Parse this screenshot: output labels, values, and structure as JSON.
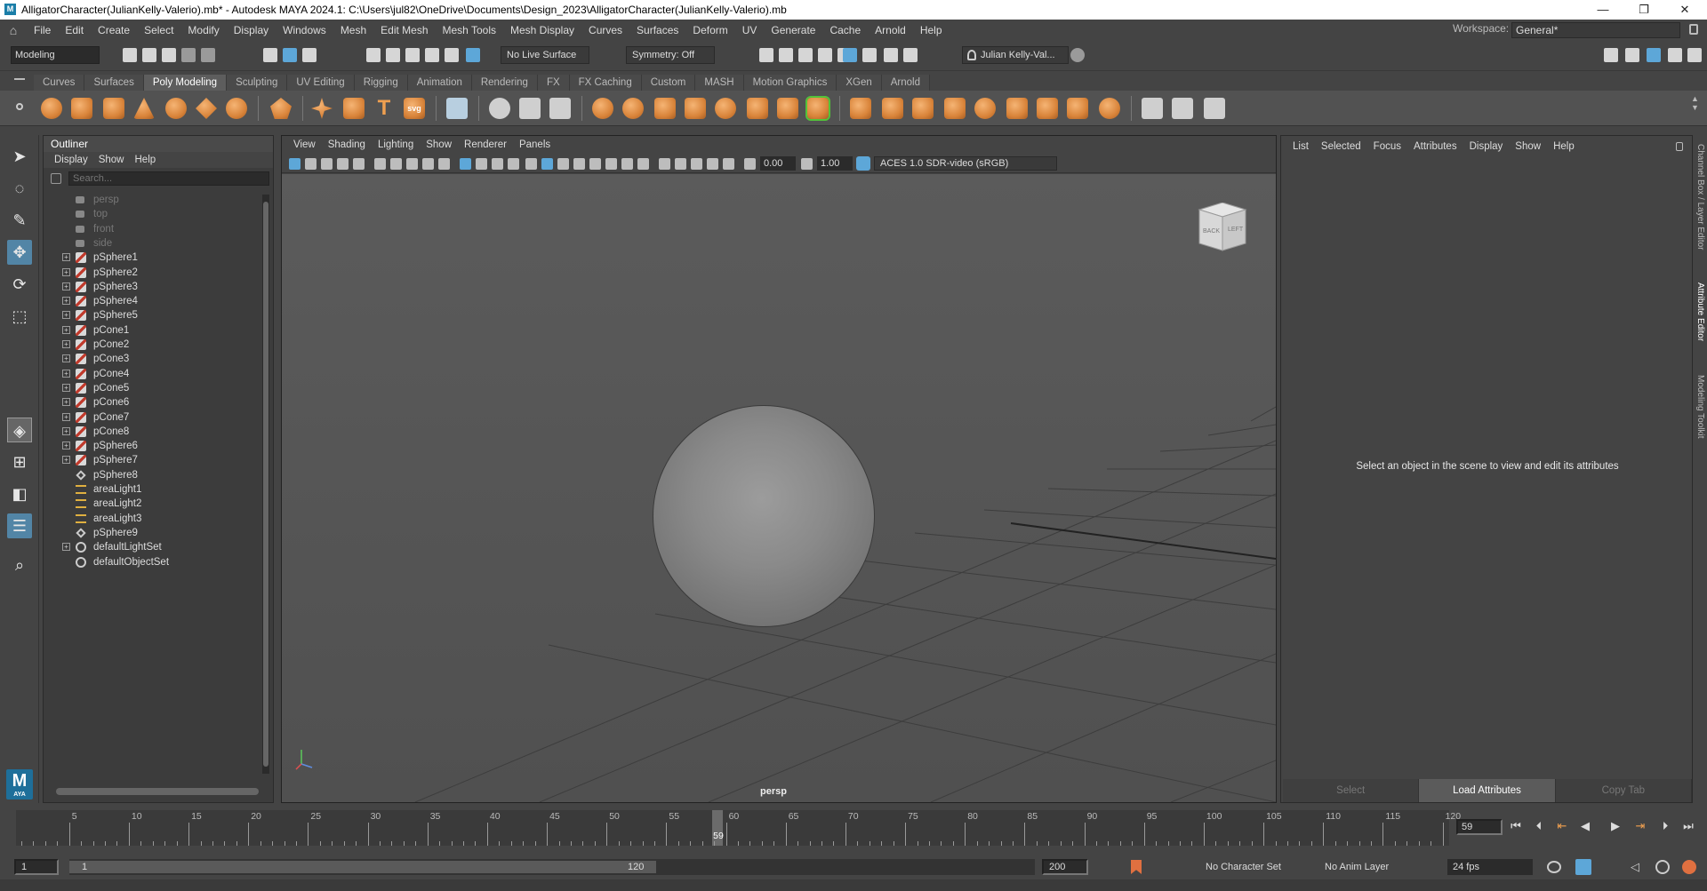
{
  "window": {
    "title": "AlligatorCharacter(JulianKelly-Valerio).mb* - Autodesk MAYA 2024.1: C:\\Users\\jul82\\OneDrive\\Documents\\Design_2023\\AlligatorCharacter(JulianKelly-Valerio).mb",
    "minimize": "—",
    "maximize": "❐",
    "close": "✕"
  },
  "menubar": {
    "items": [
      "File",
      "Edit",
      "Create",
      "Select",
      "Modify",
      "Display",
      "Windows",
      "Mesh",
      "Edit Mesh",
      "Mesh Tools",
      "Mesh Display",
      "Curves",
      "Surfaces",
      "Deform",
      "UV",
      "Generate",
      "Cache",
      "Arnold",
      "Help"
    ],
    "workspace_label": "Workspace:",
    "workspace_value": "General*"
  },
  "statusline": {
    "mode": "Modeling",
    "live_surface": "No Live Surface",
    "symmetry": "Symmetry: Off",
    "user": "Julian Kelly-Val..."
  },
  "shelf": {
    "tabs": [
      "Curves",
      "Surfaces",
      "Poly Modeling",
      "Sculpting",
      "UV Editing",
      "Rigging",
      "Animation",
      "Rendering",
      "FX",
      "FX Caching",
      "Custom",
      "MASH",
      "Motion Graphics",
      "XGen",
      "Arnold"
    ],
    "active_tab": "Poly Modeling",
    "svg_icon_text": "svg",
    "text_icon": "T"
  },
  "outliner": {
    "title": "Outliner",
    "menu": [
      "Display",
      "Show",
      "Help"
    ],
    "search_placeholder": "Search...",
    "items": [
      {
        "label": "persp",
        "icon": "camera-icon",
        "dim": true,
        "expand": false
      },
      {
        "label": "top",
        "icon": "camera-icon",
        "dim": true,
        "expand": false
      },
      {
        "label": "front",
        "icon": "camera-icon",
        "dim": true,
        "expand": false
      },
      {
        "label": "side",
        "icon": "camera-icon",
        "dim": true,
        "expand": false
      },
      {
        "label": "pSphere1",
        "icon": "mesh-icon",
        "dim": false,
        "expand": true
      },
      {
        "label": "pSphere2",
        "icon": "mesh-icon",
        "dim": false,
        "expand": true
      },
      {
        "label": "pSphere3",
        "icon": "mesh-icon",
        "dim": false,
        "expand": true
      },
      {
        "label": "pSphere4",
        "icon": "mesh-icon",
        "dim": false,
        "expand": true
      },
      {
        "label": "pSphere5",
        "icon": "mesh-icon",
        "dim": false,
        "expand": true
      },
      {
        "label": "pCone1",
        "icon": "mesh-icon",
        "dim": false,
        "expand": true
      },
      {
        "label": "pCone2",
        "icon": "mesh-icon",
        "dim": false,
        "expand": true
      },
      {
        "label": "pCone3",
        "icon": "mesh-icon",
        "dim": false,
        "expand": true
      },
      {
        "label": "pCone4",
        "icon": "mesh-icon",
        "dim": false,
        "expand": true
      },
      {
        "label": "pCone5",
        "icon": "mesh-icon",
        "dim": false,
        "expand": true
      },
      {
        "label": "pCone6",
        "icon": "mesh-icon",
        "dim": false,
        "expand": true
      },
      {
        "label": "pCone7",
        "icon": "mesh-icon",
        "dim": false,
        "expand": true
      },
      {
        "label": "pCone8",
        "icon": "mesh-icon",
        "dim": false,
        "expand": true
      },
      {
        "label": "pSphere6",
        "icon": "mesh-icon",
        "dim": false,
        "expand": true
      },
      {
        "label": "pSphere7",
        "icon": "mesh-icon",
        "dim": false,
        "expand": true
      },
      {
        "label": "pSphere8",
        "icon": "transform-icon",
        "dim": false,
        "expand": false
      },
      {
        "label": "areaLight1",
        "icon": "area-light-icon",
        "dim": false,
        "expand": false
      },
      {
        "label": "areaLight2",
        "icon": "area-light-icon",
        "dim": false,
        "expand": false
      },
      {
        "label": "areaLight3",
        "icon": "area-light-icon",
        "dim": false,
        "expand": false
      },
      {
        "label": "pSphere9",
        "icon": "transform-icon",
        "dim": false,
        "expand": false
      },
      {
        "label": "defaultLightSet",
        "icon": "set-icon",
        "dim": false,
        "expand": true
      },
      {
        "label": "defaultObjectSet",
        "icon": "set-icon",
        "dim": false,
        "expand": false
      }
    ]
  },
  "viewport": {
    "menu": [
      "View",
      "Shading",
      "Lighting",
      "Show",
      "Renderer",
      "Panels"
    ],
    "exposure": "0.00",
    "gamma": "1.00",
    "color_space": "ACES 1.0 SDR-video (sRGB)",
    "camera_label": "persp",
    "viewcube_back": "BACK",
    "viewcube_left": "LEFT"
  },
  "attribute_editor": {
    "menu": [
      "List",
      "Selected",
      "Focus",
      "Attributes",
      "Display",
      "Show",
      "Help"
    ],
    "message": "Select an object in the scene to view and edit its attributes",
    "buttons": [
      {
        "label": "Select",
        "active": false
      },
      {
        "label": "Load Attributes",
        "active": true
      },
      {
        "label": "Copy Tab",
        "active": false
      }
    ]
  },
  "side_tabs": [
    "Channel Box / Layer Editor",
    "Attribute Editor",
    "Modeling Toolkit"
  ],
  "timeline": {
    "ticks": [
      5,
      10,
      15,
      20,
      25,
      30,
      35,
      40,
      45,
      50,
      55,
      60,
      65,
      70,
      75,
      80,
      85,
      90,
      95,
      100,
      105,
      110,
      115,
      120
    ],
    "range_start": 1,
    "range_end": 120,
    "current_frame": 59,
    "current_frame_field": "59"
  },
  "range": {
    "start": "1",
    "inner_start": "1",
    "inner_end": "120",
    "end": "200",
    "character_set": "No Character Set",
    "anim_layer": "No Anim Layer",
    "fps": "24 fps"
  }
}
